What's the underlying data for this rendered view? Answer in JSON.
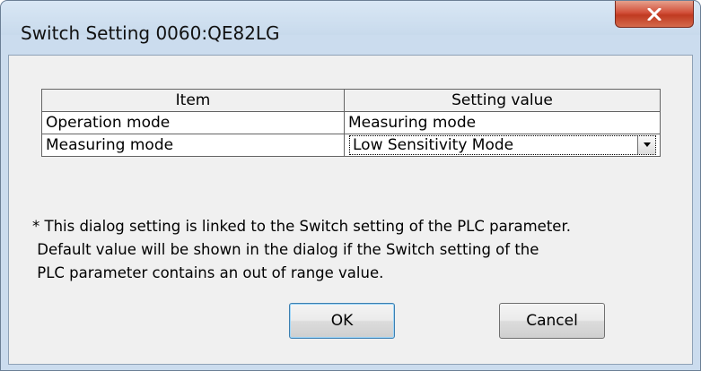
{
  "window": {
    "title": "Switch Setting 0060:QE82LG",
    "close_icon": "close-x-icon"
  },
  "grid": {
    "headers": [
      "Item",
      "Setting value"
    ],
    "rows": [
      {
        "item": "Operation mode",
        "value": "Measuring mode"
      },
      {
        "item": "Measuring mode",
        "value": "Low Sensitivity Mode",
        "control": "dropdown"
      }
    ]
  },
  "note": {
    "line1": "* This dialog setting is linked to the Switch setting of the PLC parameter.",
    "line2": " Default value will be shown in the dialog if the Switch setting of the",
    "line3": " PLC parameter contains an out of range value."
  },
  "buttons": {
    "ok": "OK",
    "cancel": "Cancel"
  },
  "colors": {
    "frame": "#cbdcee",
    "client": "#f0f0f0",
    "close_button": "#c8452c"
  }
}
